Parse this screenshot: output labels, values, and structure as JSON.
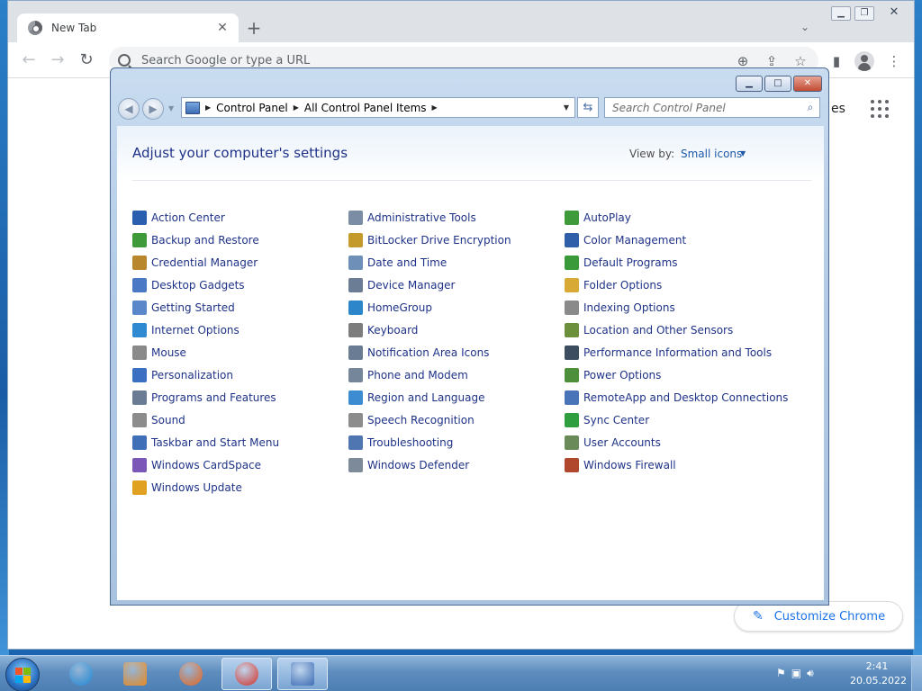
{
  "chrome": {
    "tab_title": "New Tab",
    "tab_close_glyph": "✕",
    "new_tab_glyph": "+",
    "omnibox_placeholder": "Search Google or type a URL",
    "partial_link": "es",
    "customize_label": "Customize Chrome"
  },
  "control_panel": {
    "breadcrumb": [
      "Control Panel",
      "All Control Panel Items"
    ],
    "search_placeholder": "Search Control Panel",
    "heading": "Adjust your computer's settings",
    "view_by_label": "View by:",
    "view_by_value": "Small icons",
    "columns": [
      [
        {
          "label": "Action Center",
          "icon": "flag-icon",
          "color": "#2a5fb0"
        },
        {
          "label": "Backup and Restore",
          "icon": "backup-icon",
          "color": "#3f9b3a"
        },
        {
          "label": "Credential Manager",
          "icon": "vault-icon",
          "color": "#b8872d"
        },
        {
          "label": "Desktop Gadgets",
          "icon": "gadgets-icon",
          "color": "#4a78c4"
        },
        {
          "label": "Getting Started",
          "icon": "start-icon",
          "color": "#5a87c9"
        },
        {
          "label": "Internet Options",
          "icon": "globe-icon",
          "color": "#2f8ad1"
        },
        {
          "label": "Mouse",
          "icon": "mouse-icon",
          "color": "#8a8a8a"
        },
        {
          "label": "Personalization",
          "icon": "monitor-icon",
          "color": "#3a6fc1"
        },
        {
          "label": "Programs and Features",
          "icon": "programs-icon",
          "color": "#6a7c93"
        },
        {
          "label": "Sound",
          "icon": "speaker-icon",
          "color": "#8c8c8c"
        },
        {
          "label": "Taskbar and Start Menu",
          "icon": "taskbar-icon",
          "color": "#3f6fb7"
        },
        {
          "label": "Windows CardSpace",
          "icon": "cardspace-icon",
          "color": "#7b58b8"
        },
        {
          "label": "Windows Update",
          "icon": "update-icon",
          "color": "#e0a020"
        }
      ],
      [
        {
          "label": "Administrative Tools",
          "icon": "admin-tools-icon",
          "color": "#7a8da4"
        },
        {
          "label": "BitLocker Drive Encryption",
          "icon": "bitlocker-icon",
          "color": "#c49a2c"
        },
        {
          "label": "Date and Time",
          "icon": "clock-icon",
          "color": "#6e8fb8"
        },
        {
          "label": "Device Manager",
          "icon": "device-manager-icon",
          "color": "#6b7d94"
        },
        {
          "label": "HomeGroup",
          "icon": "homegroup-icon",
          "color": "#2c86c9"
        },
        {
          "label": "Keyboard",
          "icon": "keyboard-icon",
          "color": "#7d7d7d"
        },
        {
          "label": "Notification Area Icons",
          "icon": "notification-icon",
          "color": "#6a7c93"
        },
        {
          "label": "Phone and Modem",
          "icon": "phone-icon",
          "color": "#75859a"
        },
        {
          "label": "Region and Language",
          "icon": "region-icon",
          "color": "#3d8bd0"
        },
        {
          "label": "Speech Recognition",
          "icon": "microphone-icon",
          "color": "#8c8c8c"
        },
        {
          "label": "Troubleshooting",
          "icon": "troubleshoot-icon",
          "color": "#4f76b0"
        },
        {
          "label": "Windows Defender",
          "icon": "defender-icon",
          "color": "#7d8a99"
        }
      ],
      [
        {
          "label": "AutoPlay",
          "icon": "autoplay-icon",
          "color": "#3f9b3a"
        },
        {
          "label": "Color Management",
          "icon": "color-management-icon",
          "color": "#2f5fa8"
        },
        {
          "label": "Default Programs",
          "icon": "default-programs-icon",
          "color": "#3a9a3a"
        },
        {
          "label": "Folder Options",
          "icon": "folder-icon",
          "color": "#d9a936"
        },
        {
          "label": "Indexing Options",
          "icon": "indexing-icon",
          "color": "#8a8a8a"
        },
        {
          "label": "Location and Other Sensors",
          "icon": "sensors-icon",
          "color": "#6b8f3a"
        },
        {
          "label": "Performance Information and Tools",
          "icon": "performance-icon",
          "color": "#3c4d5f"
        },
        {
          "label": "Power Options",
          "icon": "power-icon",
          "color": "#4d8f3a"
        },
        {
          "label": "RemoteApp and Desktop Connections",
          "icon": "remoteapp-icon",
          "color": "#4a74b8"
        },
        {
          "label": "Sync Center",
          "icon": "sync-icon",
          "color": "#2e9e3e"
        },
        {
          "label": "User Accounts",
          "icon": "users-icon",
          "color": "#6b8a5a"
        },
        {
          "label": "Windows Firewall",
          "icon": "firewall-icon",
          "color": "#b0482e"
        }
      ]
    ]
  },
  "taskbar": {
    "apps": [
      {
        "name": "internet-explorer",
        "color": "#1e88d6"
      },
      {
        "name": "media-player",
        "color": "#e98a1f"
      },
      {
        "name": "firefox",
        "color": "#e8641c"
      },
      {
        "name": "chrome",
        "color": "#d93025"
      },
      {
        "name": "control-panel",
        "color": "#3e6db5"
      }
    ],
    "time": "2:41",
    "date": "20.05.2022"
  }
}
